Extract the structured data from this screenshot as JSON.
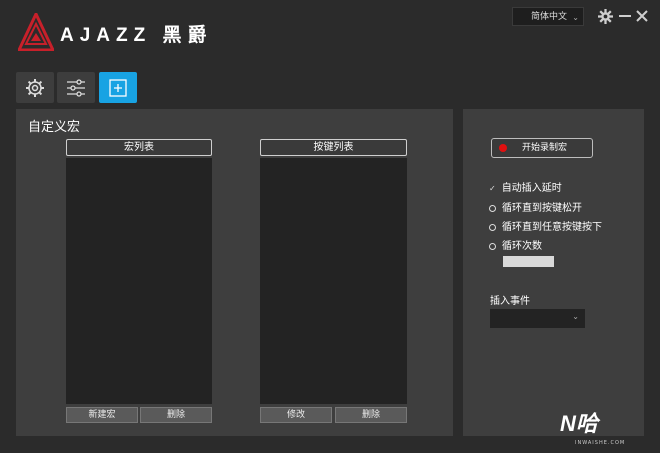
{
  "header": {
    "logo_text": "AJAZZ 黑爵",
    "language": "简体中文",
    "icons": [
      "gear-icon",
      "minimize-icon",
      "close-icon"
    ]
  },
  "tabs": [
    {
      "icon": "gear-icon",
      "active": false
    },
    {
      "icon": "sliders-icon",
      "active": false
    },
    {
      "icon": "add-square-icon",
      "active": true
    }
  ],
  "panel": {
    "title": "自定义宏",
    "macro_list": {
      "header": "宏列表",
      "new_label": "新建宏",
      "delete_label": "删除"
    },
    "key_list": {
      "header": "按键列表",
      "edit_label": "修改",
      "delete_label": "删除"
    }
  },
  "right": {
    "record_label": "开始录制宏",
    "options": {
      "auto_delay": "自动插入延时",
      "loop_until_release": "循环直到按键松开",
      "loop_until_any_key": "循环直到任意按键按下",
      "loop_count": "循环次数"
    },
    "loop_count_value": "",
    "insert_event_label": "插入事件",
    "insert_event_value": ""
  },
  "watermark": {
    "text": "N哈",
    "sub": "INWAISHE.COM"
  },
  "colors": {
    "accent": "#18a3e3",
    "record": "#e01010",
    "logo": "#c8202a"
  }
}
